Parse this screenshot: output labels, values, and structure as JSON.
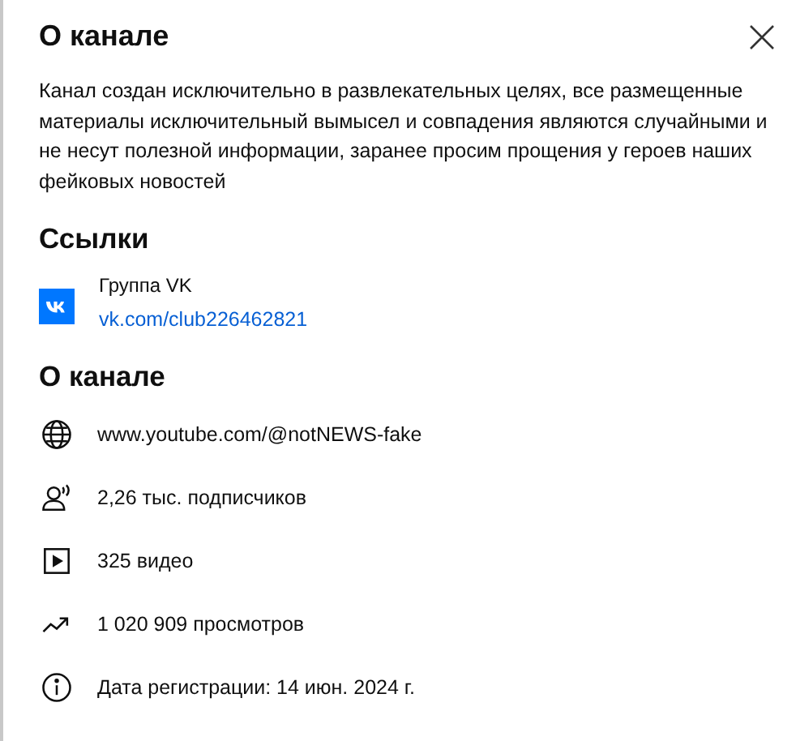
{
  "dialog": {
    "title": "О канале",
    "description": "Канал создан исключительно в развлекательных целях, все размещенные материалы исключительный вымысел и совпадения являются случайными и не несут полезной информации, заранее просим прощения у героев наших фейковых новостей"
  },
  "links": {
    "heading": "Ссылки",
    "items": [
      {
        "kind": "vk",
        "title": "Группа VK",
        "url": "vk.com/club226462821"
      }
    ]
  },
  "details": {
    "heading": "О канале",
    "items": [
      {
        "kind": "globe",
        "text": "www.youtube.com/@notNEWS-fake"
      },
      {
        "kind": "subscribers",
        "text": "2,26 тыс. подписчиков"
      },
      {
        "kind": "videos",
        "text": "325 видео"
      },
      {
        "kind": "views",
        "text": "1 020 909 просмотров"
      },
      {
        "kind": "info",
        "text": "Дата регистрации: 14 июн. 2024 г."
      }
    ]
  }
}
